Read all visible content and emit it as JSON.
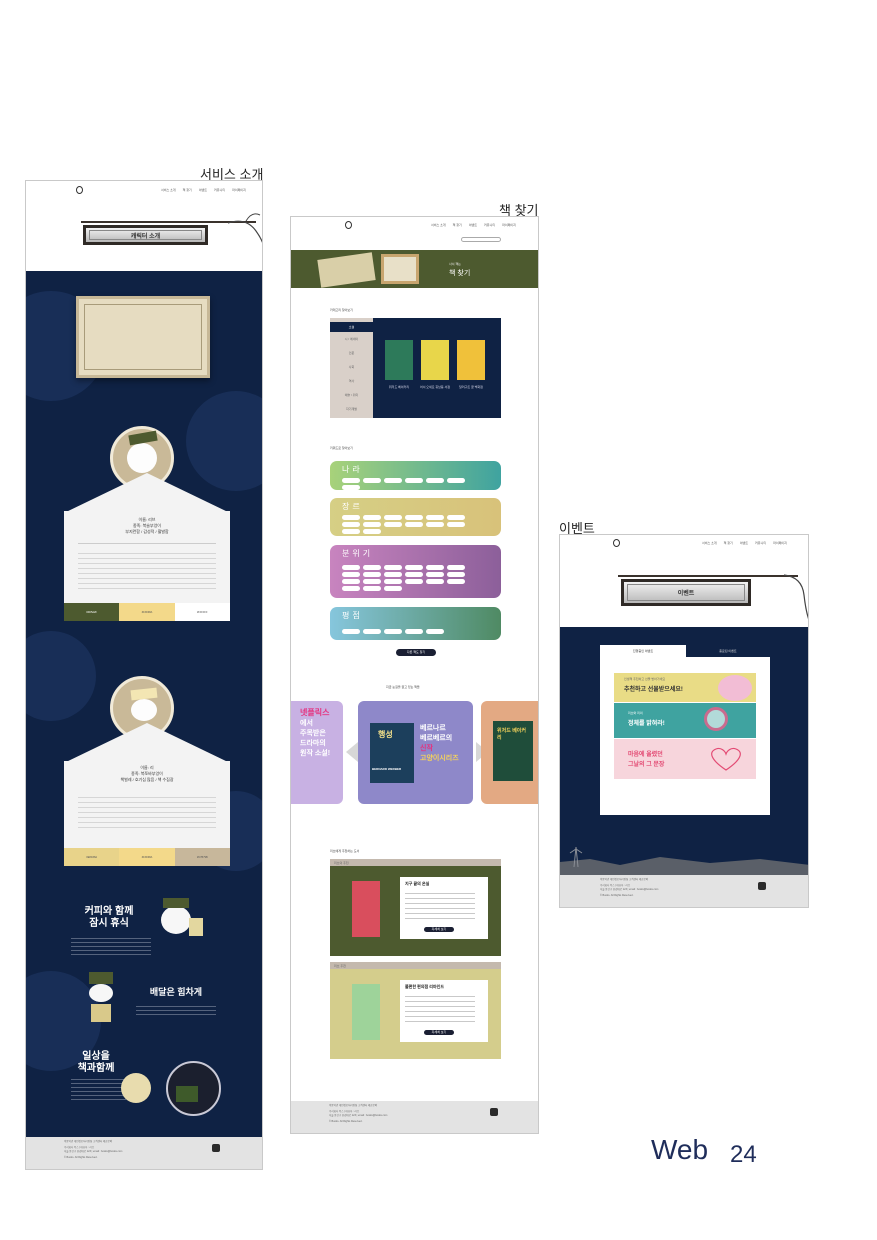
{
  "captions": {
    "service": "서비스 소개",
    "books": "책 찾기",
    "event": "이벤트"
  },
  "nav": [
    "서비스 소개",
    "책 찾기",
    "이벤트",
    "커뮤니티",
    "마이페이지"
  ],
  "service_page": {
    "sign": "캐릭터 소개",
    "char1": {
      "name_line": "이름: 리브",
      "species_line": "종족: 북슬부엉이",
      "traits": "부지런함 / 감성적 / 활발함",
      "swatches": [
        {
          "label": "#4D5A2F",
          "color": "#4d5a2f"
        },
        {
          "label": "#F3D98A",
          "color": "#f3d98a"
        },
        {
          "label": "#FFFFFF",
          "color": "#ffffff"
        }
      ]
    },
    "char2": {
      "name_line": "이름: 리",
      "species_line": "종족: 북쪼바부엉이",
      "traits": "책벌레 / 호기심 많음 / 책 수집광",
      "swatches": [
        {
          "label": "#E8D38A",
          "color": "#e8d38a"
        },
        {
          "label": "#F3D98A",
          "color": "#f3d98a"
        },
        {
          "label": "#C7B79B",
          "color": "#c7b79b"
        }
      ]
    },
    "scene1": "커피와 함께\n잠시 휴식",
    "scene2": "배달은 힘차게",
    "scene3": "일상을\n책과함께"
  },
  "books_page": {
    "hero": "책 찾기",
    "hero_sub": "사서 책는",
    "s1_title": "카테고리 찾아보기",
    "categories": [
      "소설",
      "시 / 에세이",
      "인문",
      "사회",
      "역사",
      "예술 / 취미",
      "자기계발"
    ],
    "cat_books": [
      {
        "title": "위저드 베이커리",
        "color": "#2d7a5a"
      },
      {
        "title": "어서 오세요 휴남동 서점",
        "color": "#e8d64a"
      },
      {
        "title": "달러구트 꿈 백화점",
        "color": "#f0c13a"
      }
    ],
    "s2_title": "키워드로 찾아보기",
    "filters": [
      {
        "label": "나라",
        "color": "#8fc06b"
      },
      {
        "label": "장르",
        "color": "#cfc26e"
      },
      {
        "label": "분위기",
        "color": "#b672b0"
      },
      {
        "label": "평점",
        "color": "#7bbfd3"
      }
    ],
    "search_btn": "다른 책도 찾기",
    "s3_title": "지금 눈길을 끌고 있는 책들",
    "slides": [
      {
        "line1": "넷플릭스",
        "line2": "에서",
        "line3": "주목받은",
        "line4": "드라마의",
        "line5": "원작 소설!"
      },
      {
        "line1": "베르나르",
        "line2": "베르베르의",
        "line3": "신작",
        "line4": "고양이시리즈",
        "book": "행성",
        "author": "BERNARD WERBER"
      },
      {
        "book": "위저드 베이커리"
      }
    ],
    "s4_title": "리브에게 추천하는 도서",
    "rec1_tag": "리브의 추천",
    "rec1_title": "지구 끝의 온실",
    "rec1_btn": "자세히 보기",
    "rec2_tag": "리브 추천",
    "rec2_title": "불편한 편의점 리마인드",
    "rec2_btn": "자세히 보기"
  },
  "event_page": {
    "sign": "이벤트",
    "tab_active": "진행중인 이벤트",
    "tab_other": "종료된 이벤트",
    "banner1_small": "인생책 추천하고 선물 받아가세요",
    "banner1": "추천하고 선물받으세요!",
    "banner2_small": "리브와 리의",
    "banner2": "정체를 밝혀라!",
    "banner3a": "마음에 울렸던",
    "banner3b": "그날의 그 문장"
  },
  "footer": {
    "links": "이용약관   개인정보처리방침   고객센터   제휴문의",
    "line1": "주식회사 북스 | 대표자 : 리브",
    "line2": "서울 용산구 한강대로 123 | email : books@books.com",
    "copyright": "© Books. All Rights Reserved."
  },
  "page_label": "Web",
  "page_number": "24"
}
